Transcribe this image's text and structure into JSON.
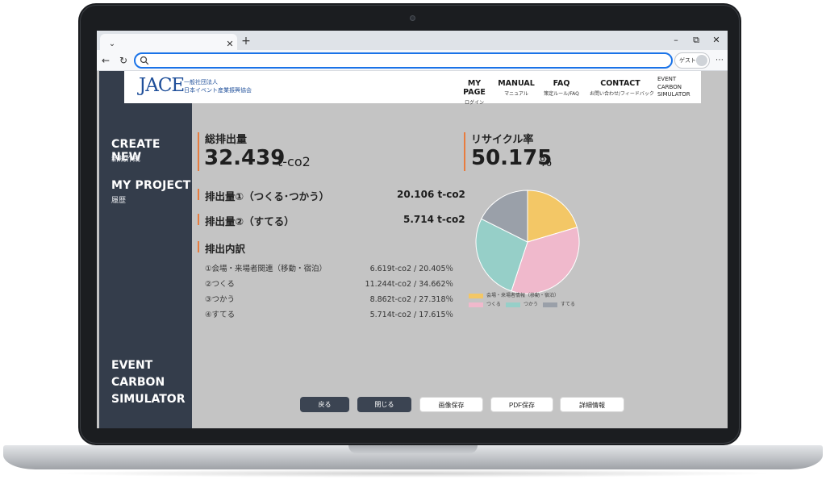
{
  "browser": {
    "tab_dropdown": "⌄",
    "tab_close": "✕",
    "new_tab": "+",
    "minimize": "–",
    "restore": "⧉",
    "close": "✕",
    "back": "←",
    "refresh": "↻",
    "guest_label": "ゲスト",
    "more": "⋯"
  },
  "sidebar": {
    "create_en": "CREATE NEW",
    "create_jp": "新規作成",
    "project_en": "MY PROJECT",
    "project_jp": "履歴",
    "footer": [
      "EVENT",
      "CARBON",
      "SIMULATOR"
    ]
  },
  "header": {
    "logo": "JACE",
    "logo_sub_1": "一般社団法人",
    "logo_sub_2": "日本イベント産業振興協会",
    "nav": [
      {
        "en": "MY PAGE",
        "jp": "ログイン"
      },
      {
        "en": "MANUAL",
        "jp": "マニュアル"
      },
      {
        "en": "FAQ",
        "jp": "策定ルール/FAQ"
      },
      {
        "en": "CONTACT",
        "jp": "お問い合わせ/フィードバック"
      }
    ],
    "ecs": [
      "EVENT",
      "CARBON",
      "SIMULATOR"
    ]
  },
  "metrics": {
    "total_label": "総排出量",
    "total_value": "32.439",
    "total_unit": "t-co2",
    "recycle_label": "リサイクル率",
    "recycle_value": "50.175",
    "recycle_unit": "%",
    "emission1_label": "排出量①（つくる･つかう）",
    "emission1_value": "20.106 t-co2",
    "emission2_label": "排出量②（すてる）",
    "emission2_value": "5.714 t-co2",
    "breakdown_label": "排出内訳"
  },
  "breakdown": [
    {
      "label": "①会場・来場者関連（移動・宿泊）",
      "value": "6.619t-co2 / 20.405％"
    },
    {
      "label": "②つくる",
      "value": "11.244t-co2 / 34.662％"
    },
    {
      "label": "③つかう",
      "value": "8.862t-co2 / 27.318％"
    },
    {
      "label": "④すてる",
      "value": "5.714t-co2 / 17.615％"
    }
  ],
  "chart_data": {
    "type": "pie",
    "categories": [
      "会場・来場者情報（移動・宿泊）",
      "つくる",
      "つかう",
      "すてる"
    ],
    "values": [
      20.405,
      34.662,
      27.318,
      17.615
    ],
    "colors": [
      "#f3c766",
      "#f0b9cc",
      "#96cfc8",
      "#9aa0a9"
    ],
    "legend": "bottom"
  },
  "buttons": {
    "back": "戻る",
    "close": "閉じる",
    "save_image": "画像保存",
    "save_pdf": "PDF保存",
    "details": "詳細情報"
  }
}
